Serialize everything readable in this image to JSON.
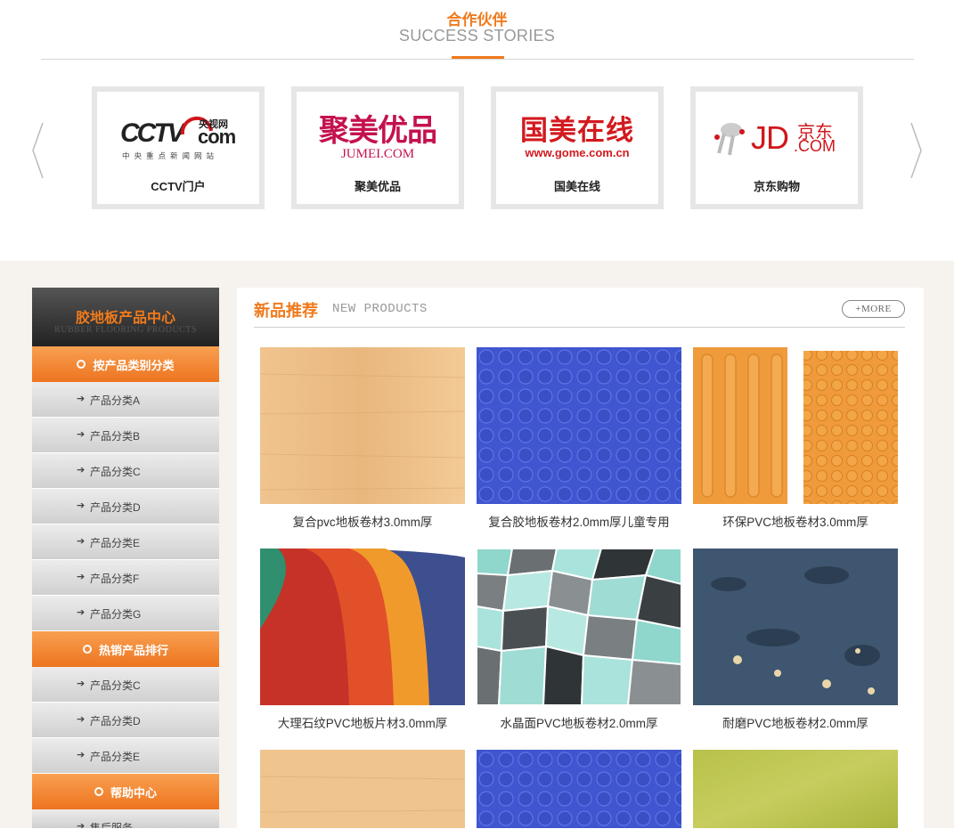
{
  "partners": {
    "title": "合作伙伴",
    "subtitle": "SUCCESS STORIES",
    "accent_color": "#f07a1c",
    "prev_icon": "chevron-left-icon",
    "next_icon": "chevron-right-icon",
    "items": [
      {
        "name": "CCTV门户",
        "logo_main": "CCTV",
        "logo_com": "com",
        "logo_cn": "央视网",
        "logo_tag": "中央重点新闻网站"
      },
      {
        "name": "聚美优品",
        "logo_main": "聚美优品",
        "logo_sub": "JUMEI.COM"
      },
      {
        "name": "国美在线",
        "logo_main": "国美在线",
        "logo_sub": "www.gome.com.cn"
      },
      {
        "name": "京东购物",
        "logo_main": "JD",
        "logo_com": ".COM",
        "logo_cn": "京东"
      }
    ]
  },
  "sidebar": {
    "title": "胶地板产品中心",
    "subtitle": "RUBBER FLOORING PRODUCTS",
    "arrow": "➔",
    "categories": [
      {
        "label": "按产品类别分类",
        "items": [
          "产品分类A",
          "产品分类B",
          "产品分类C",
          "产品分类D",
          "产品分类E",
          "产品分类F",
          "产品分类G"
        ]
      },
      {
        "label": "热销产品排行",
        "items": [
          "产品分类C",
          "产品分类D",
          "产品分类E"
        ]
      },
      {
        "label": "帮助中心",
        "items": [
          "售后服务"
        ]
      }
    ]
  },
  "main": {
    "title": "新品推荐",
    "subtitle": "NEW PRODUCTS",
    "more": "+MORE",
    "products": [
      {
        "name": "复合pvc地板卷材3.0mm厚",
        "texture": "wood"
      },
      {
        "name": "复合胶地板卷材2.0mm厚儿童专用",
        "texture": "blue-dots"
      },
      {
        "name": "环保PVC地板卷材3.0mm厚",
        "texture": "tactile"
      },
      {
        "name": "大理石纹PVC地板片材3.0mm厚",
        "texture": "sheets"
      },
      {
        "name": "水晶面PVC地板卷材2.0mm厚",
        "texture": "crystal"
      },
      {
        "name": "耐磨PVC地板卷材2.0mm厚",
        "texture": "terrazzo"
      },
      {
        "name": "",
        "texture": "wood"
      },
      {
        "name": "",
        "texture": "blue-dots"
      },
      {
        "name": "",
        "texture": "green"
      }
    ]
  }
}
